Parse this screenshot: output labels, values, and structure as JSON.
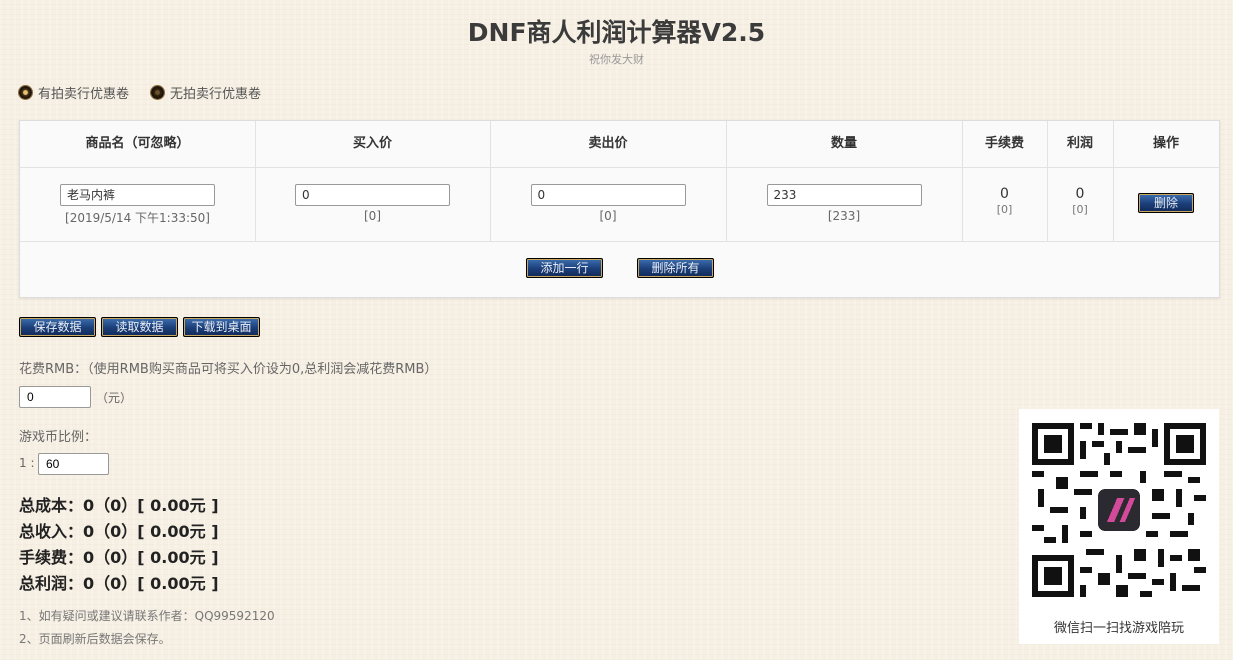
{
  "header": {
    "title": "DNF商人利润计算器V2.5",
    "subtitle": "祝你发大财"
  },
  "coupon": {
    "options": [
      "有拍卖行优惠卷",
      "无拍卖行优惠卷"
    ],
    "selected": "有拍卖行优惠卷"
  },
  "table": {
    "headers": [
      "商品名（可忽略）",
      "买入价",
      "卖出价",
      "数量",
      "手续费",
      "利润",
      "操作"
    ],
    "rows": [
      {
        "name": "老马内裤",
        "timestamp": "[2019/5/14 下午1:33:50]",
        "buy": "0",
        "buy_sub": "[0]",
        "sell": "0",
        "sell_sub": "[0]",
        "qty": "233",
        "qty_sub": "[233]",
        "fee": "0",
        "fee_sub": "[0]",
        "profit": "0",
        "profit_sub": "[0]",
        "delete_label": "删除"
      }
    ],
    "add_row_label": "添加一行",
    "delete_all_label": "删除所有"
  },
  "actions": {
    "save": "保存数据",
    "load": "读取数据",
    "download": "下载到桌面"
  },
  "rmb": {
    "label": "花费RMB：（使用RMB购买商品可将买入价设为0,总利润会减花费RMB）",
    "value": "0",
    "unit": "（元）"
  },
  "ratio": {
    "label": "游戏币比例：",
    "prefix": "1 :",
    "value": "60"
  },
  "totals": [
    "总成本：0（0）[ 0.00元 ]",
    "总收入：0（0）[ 0.00元 ]",
    "手续费：0（0）[ 0.00元 ]",
    "总利润：0（0）[ 0.00元 ]"
  ],
  "notes": [
    "1、如有疑问或建议请联系作者：QQ99592120",
    "2、页面刷新后数据会保存。"
  ],
  "qr_caption": "微信扫一扫找游戏陪玩",
  "colors": {
    "button": "#1b3e78",
    "button_border": "#c8a860",
    "background": "#f6efe3"
  }
}
